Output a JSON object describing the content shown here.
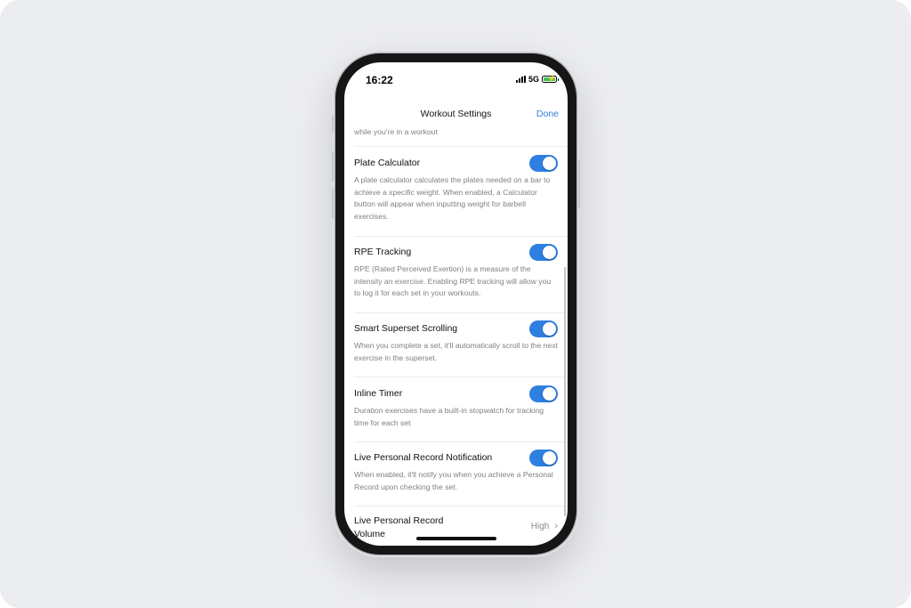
{
  "status": {
    "time": "16:22",
    "network": "5G"
  },
  "nav": {
    "title": "Workout Settings",
    "done": "Done"
  },
  "prev_desc_tail": "while you're in a workout",
  "settings": [
    {
      "title": "Plate Calculator",
      "desc": "A plate calculator calculates the plates needed on a bar to achieve a specific weight. When enabled, a Calculator button will appear when inputting weight for barbell exercises.",
      "enabled": true
    },
    {
      "title": "RPE Tracking",
      "desc": "RPE (Rated Perceived Exertion) is a measure of the intensity an exercise. Enabling RPE tracking will allow you to log it for each set in your workouts.",
      "enabled": true
    },
    {
      "title": "Smart Superset Scrolling",
      "desc": "When you complete a set, it'll automatically scroll to the next exercise in the superset.",
      "enabled": true
    },
    {
      "title": "Inline Timer",
      "desc": "Duration exercises have a built-in stopwatch for tracking time for each set",
      "enabled": true
    },
    {
      "title": "Live Personal Record Notification",
      "desc": "When enabled, it'll notify you when you achieve a Personal Record upon checking the set.",
      "enabled": true
    }
  ],
  "volume_row": {
    "title_line1": "Live Personal Record",
    "title_line2": "Volume",
    "value": "High"
  },
  "colors": {
    "accent": "#2f7fe0",
    "toggle_on": "#2f7fe0",
    "backdrop": "#ecedf0"
  },
  "icons": {
    "signal": "signal-bars-icon",
    "battery": "battery-charging-icon",
    "chevron": "chevron-right-icon"
  }
}
